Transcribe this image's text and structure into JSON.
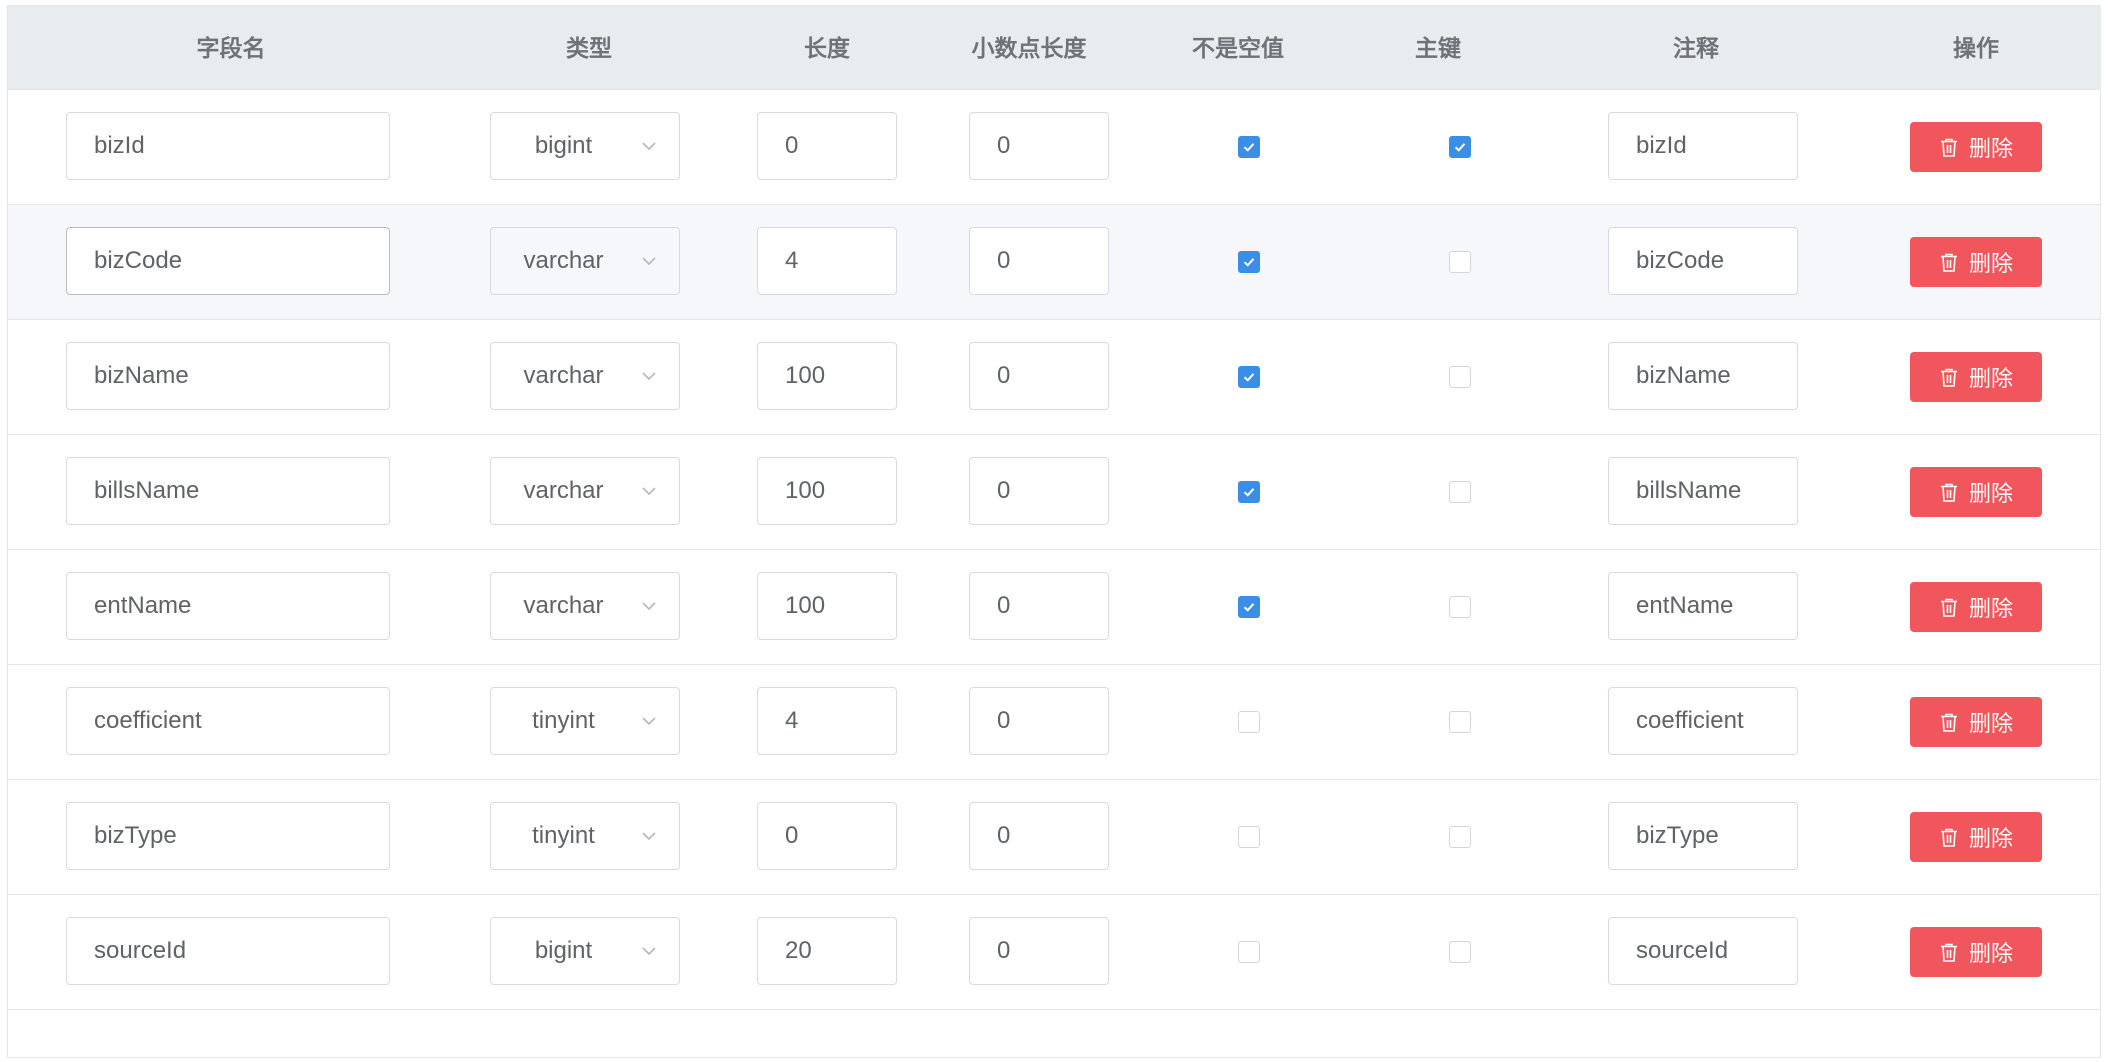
{
  "columns": {
    "field_name": "字段名",
    "type": "类型",
    "length": "长度",
    "decimal": "小数点长度",
    "not_null": "不是空值",
    "primary_key": "主键",
    "comment": "注释",
    "action": "操作"
  },
  "delete_label": "删除",
  "icons": {
    "delete": "trash-icon",
    "select": "chevron-down-icon",
    "checked": "checkmark-icon"
  },
  "colors": {
    "header_bg": "#e9ecef",
    "checkbox_checked": "#3a8ee6",
    "delete_button": "#f0565b"
  },
  "rows": [
    {
      "field": "bizId",
      "type": "bigint",
      "length": "0",
      "decimal": "0",
      "not_null": true,
      "primary_key": true,
      "comment": "bizId"
    },
    {
      "field": "bizCode",
      "type": "varchar",
      "length": "4",
      "decimal": "0",
      "not_null": true,
      "primary_key": false,
      "comment": "bizCode"
    },
    {
      "field": "bizName",
      "type": "varchar",
      "length": "100",
      "decimal": "0",
      "not_null": true,
      "primary_key": false,
      "comment": "bizName"
    },
    {
      "field": "billsName",
      "type": "varchar",
      "length": "100",
      "decimal": "0",
      "not_null": true,
      "primary_key": false,
      "comment": "billsName"
    },
    {
      "field": "entName",
      "type": "varchar",
      "length": "100",
      "decimal": "0",
      "not_null": true,
      "primary_key": false,
      "comment": "entName"
    },
    {
      "field": "coefficient",
      "type": "tinyint",
      "length": "4",
      "decimal": "0",
      "not_null": false,
      "primary_key": false,
      "comment": "coefficient"
    },
    {
      "field": "bizType",
      "type": "tinyint",
      "length": "0",
      "decimal": "0",
      "not_null": false,
      "primary_key": false,
      "comment": "bizType"
    },
    {
      "field": "sourceId",
      "type": "bigint",
      "length": "20",
      "decimal": "0",
      "not_null": false,
      "primary_key": false,
      "comment": "sourceId"
    }
  ]
}
